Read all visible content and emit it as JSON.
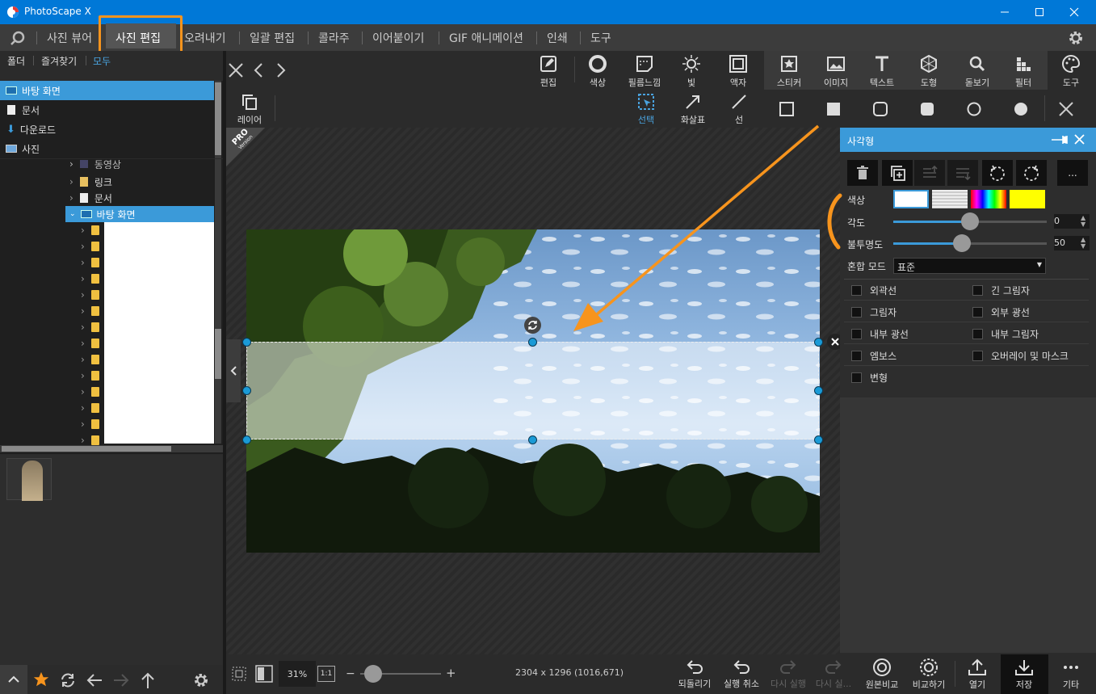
{
  "window": {
    "title": "PhotoScape X"
  },
  "main_tabs": [
    "사진 뷰어",
    "사진 편집",
    "오려내기",
    "일괄 편집",
    "콜라주",
    "이어붙이기",
    "GIF 애니메이션",
    "인쇄",
    "도구"
  ],
  "active_tab": "사진 편집",
  "left": {
    "subtabs": [
      "폴더",
      "즐겨찾기",
      "모두"
    ],
    "quick_items": [
      "바탕 화면",
      "문서",
      "다운로드",
      "사진"
    ],
    "tree": {
      "cut_item": "동영상",
      "link": "링크",
      "docs": "문서",
      "desktop": "바탕 화면"
    }
  },
  "toolbar_top": {
    "edit": "편집",
    "color": "색상",
    "film": "필름느낌",
    "light": "빛",
    "frame": "액자",
    "sticker": "스티커",
    "image": "이미지",
    "text": "텍스트",
    "shape": "도형",
    "magnifier": "돋보기",
    "filter": "필터",
    "tools": "도구"
  },
  "toolbar_second": {
    "layer": "레이어",
    "select": "선택",
    "arrow": "화살표",
    "line": "선"
  },
  "pro_badge": {
    "line1": "PRO",
    "line2": "Version"
  },
  "panel": {
    "title": "사각형",
    "more": "...",
    "color_label": "색상",
    "angle_label": "각도",
    "angle_value": "0",
    "opacity_label": "불투명도",
    "opacity_value": "50",
    "blend_label": "혼합 모드",
    "blend_value": "표준",
    "checkboxes": [
      "외곽선",
      "긴 그림자",
      "그림자",
      "외부 광선",
      "내부 광선",
      "내부 그림자",
      "엠보스",
      "오버레이 및 마스크",
      "변형"
    ],
    "swatch_colors": [
      "#ffffff",
      "#ffff00"
    ],
    "accent": "#f7941d"
  },
  "bottom": {
    "zoom": "31%",
    "one_to_one": "1:1",
    "dims": "2304 x 1296 (1016,671)",
    "undo_all": "되돌리기",
    "undo": "실행 취소",
    "redo": "다시 실행",
    "redo_all": "다시 실...",
    "original": "원본비교",
    "compare": "비교하기",
    "open": "열기",
    "save": "저장",
    "more": "기타"
  }
}
